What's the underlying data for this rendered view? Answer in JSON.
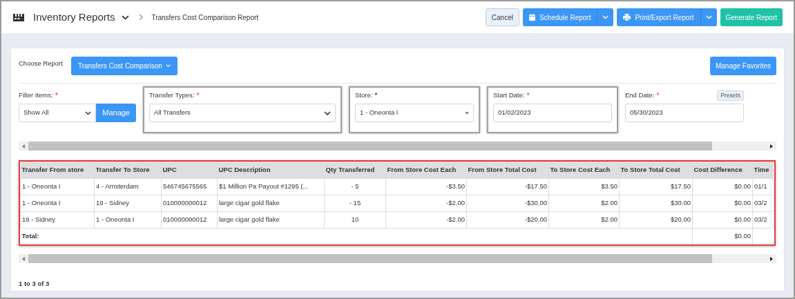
{
  "header": {
    "title": "Inventory Reports",
    "breadcrumb": "Transfers Cost Comparison Report",
    "buttons": [
      {
        "kind": "cancel",
        "label": "Cancel"
      },
      {
        "kind": "schedule",
        "label": "Schedule Report"
      },
      {
        "kind": "print",
        "label": "Print/Export Report"
      },
      {
        "kind": "generate",
        "label": "Generate Report"
      }
    ]
  },
  "report": {
    "label": "Choose Report",
    "selected": "Transfers Cost Comparison",
    "favorites": "Manage Favorites"
  },
  "filters": [
    {
      "kind": "select-manage",
      "label": "Filter Items:",
      "mark": "*",
      "emphasized": true,
      "value": "Show All",
      "button": "Manage",
      "highlighted": false
    },
    {
      "kind": "select",
      "label": "Transfer Types:",
      "mark": "*",
      "emphasized": true,
      "value": "All Transfers",
      "highlighted": true
    },
    {
      "kind": "combo",
      "label": "Store:",
      "mark": "*",
      "emphasized": false,
      "value": "1 - Oneonta I",
      "highlighted": true
    },
    {
      "kind": "date",
      "label": "Start Date:",
      "mark": "*",
      "emphasized": true,
      "value": "01/02/2023",
      "highlighted": true
    },
    {
      "kind": "date-presets",
      "label": "End Date:",
      "mark": "*",
      "emphasized": true,
      "value": "05/30/2023",
      "button": "Presets",
      "highlighted": false
    }
  ],
  "table": {
    "columns": [
      {
        "label": "Transfer From store",
        "kind": "text"
      },
      {
        "label": "Transfer To Store",
        "kind": "text"
      },
      {
        "label": "UPC",
        "kind": "text"
      },
      {
        "label": "UPC Description",
        "kind": "text"
      },
      {
        "label": "Qty Transferred",
        "kind": "quantity"
      },
      {
        "label": "From Store Cost Each",
        "kind": "money"
      },
      {
        "label": "From Store Total Cost",
        "kind": "money"
      },
      {
        "label": "To Store Cost Each",
        "kind": "money"
      },
      {
        "label": "To Store Total Cost",
        "kind": "money"
      },
      {
        "label": "Cost Difference",
        "kind": "money"
      },
      {
        "label": "Time",
        "kind": "text"
      }
    ],
    "rows": [
      [
        "1 - Oneonta I",
        "4 - Amsterdam",
        "546745675565",
        "$1 Million Pa Payout #1295 (...",
        "- 5",
        "-$3.50",
        "-$17.50",
        "$3.50",
        "$17.50",
        "$0.00",
        "01/1"
      ],
      [
        "1 - Oneonta I",
        "19 - Sidney",
        "010000000012",
        "large cigar gold flake",
        "- 15",
        "-$2.00",
        "-$30.00",
        "$2.00",
        "$30.00",
        "$0.00",
        "03/2"
      ],
      [
        "19 - Sidney",
        "1 - Oneonta I",
        "010000000012",
        "large cigar gold flake",
        "10",
        "-$2.00",
        "-$20.00",
        "$2.00",
        "$20.00",
        "$0.00",
        "03/2"
      ]
    ],
    "total": {
      "label": "Total:",
      "cost_difference": "$0.00"
    }
  },
  "pagination": "1 to 3 of 3"
}
